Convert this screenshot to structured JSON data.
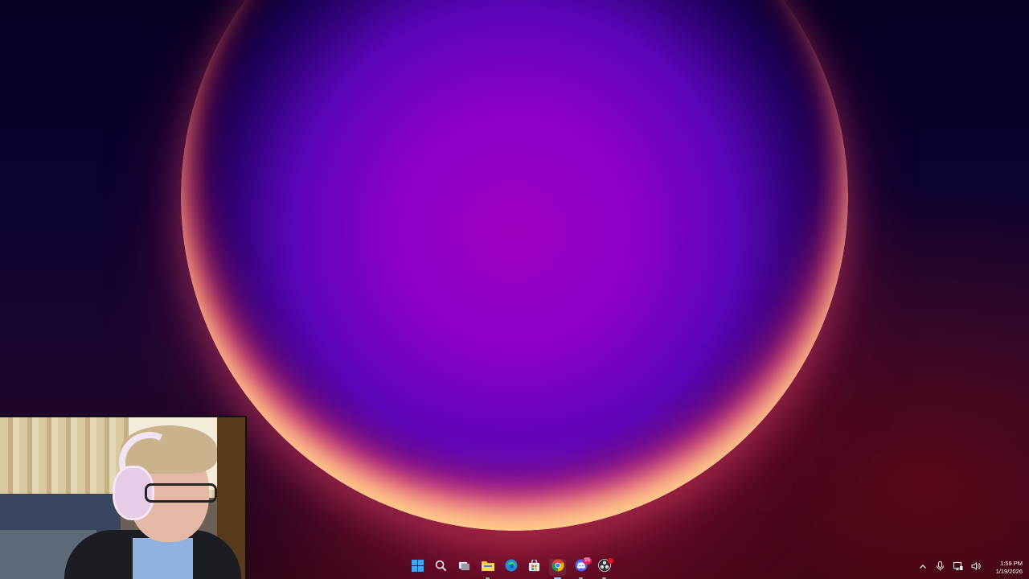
{
  "taskbar": {
    "apps": [
      {
        "name": "Start",
        "icon": "windows-start-icon",
        "active": false
      },
      {
        "name": "Search",
        "icon": "search-icon",
        "active": false
      },
      {
        "name": "Task View",
        "icon": "task-view-icon",
        "active": false
      },
      {
        "name": "File Explorer",
        "icon": "folder-icon",
        "active": false
      },
      {
        "name": "Microsoft Edge",
        "icon": "edge-icon",
        "active": false
      },
      {
        "name": "Microsoft Store",
        "icon": "store-icon",
        "active": false
      },
      {
        "name": "Google Chrome",
        "icon": "chrome-icon",
        "active": true
      },
      {
        "name": "Discord",
        "icon": "discord-icon",
        "active": false,
        "badge": "99"
      },
      {
        "name": "OBS Studio",
        "icon": "obs-icon",
        "active": false
      }
    ],
    "tray": {
      "icons": [
        "chevron-up-icon",
        "microphone-icon",
        "network-icon",
        "volume-icon"
      ],
      "time": "1:59 PM",
      "date": "1/19/2026"
    }
  },
  "colors": {
    "accent": "#8ed0ff",
    "badge": "#e0245e"
  }
}
